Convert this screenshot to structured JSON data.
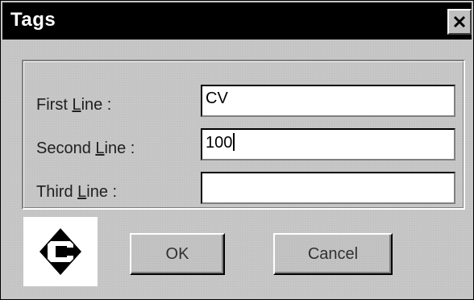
{
  "window": {
    "title": "Tags",
    "close_icon": "close-icon"
  },
  "fields": [
    {
      "label_prefix": "First ",
      "label_accel": "L",
      "label_suffix": "ine :",
      "value": "CV"
    },
    {
      "label_prefix": "Second ",
      "label_accel": "L",
      "label_suffix": "ine :",
      "value": "100"
    },
    {
      "label_prefix": "Third ",
      "label_accel": "L",
      "label_suffix": "ine :",
      "value": ""
    }
  ],
  "logo": {
    "icon": "c-diamond-logo-icon",
    "letter": "C"
  },
  "buttons": {
    "ok_label": "OK",
    "cancel_label": "Cancel"
  }
}
